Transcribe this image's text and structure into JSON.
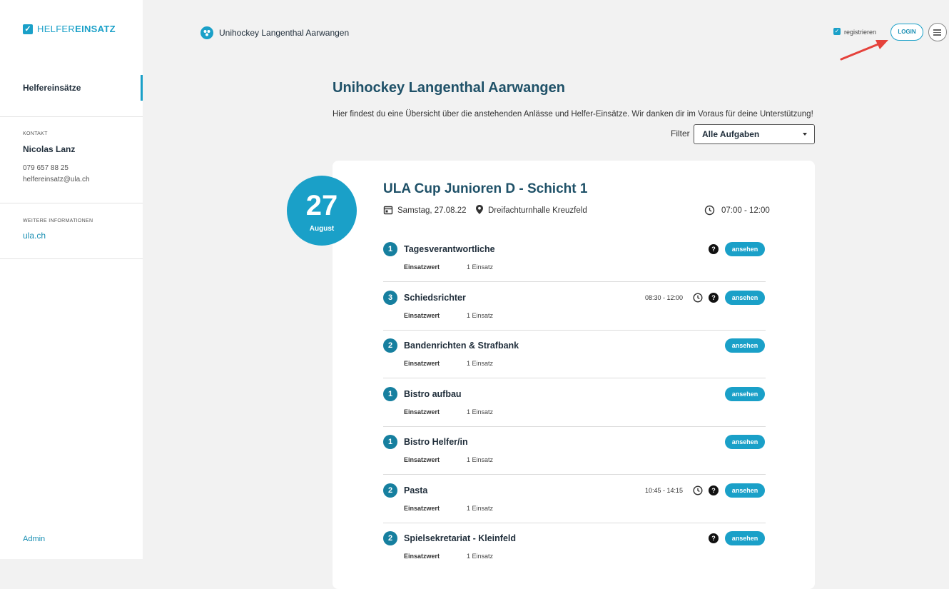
{
  "app": {
    "logo_light": "HELFER",
    "logo_bold": "EINSATZ"
  },
  "sidebar": {
    "nav_active": "Helfereinsätze",
    "contact_caption": "KONTAKT",
    "contact_name": "Nicolas Lanz",
    "contact_phone": "079 657 88 25",
    "contact_email": "helfereinsatz@ula.ch",
    "info_caption": "WEITERE INFORMATIONEN",
    "info_link": "ula.ch",
    "admin_link": "Admin"
  },
  "header": {
    "org_name": "Unihockey Langenthal Aarwangen",
    "register_label": "registrieren",
    "login_label": "LOGIN"
  },
  "main": {
    "title": "Unihockey Langenthal Aarwangen",
    "intro": "Hier findest du eine Übersicht über die anstehenden Anlässe und Helfer-Einsätze. Wir danken dir im Voraus für deine Unterstützung!",
    "filter_label": "Filter",
    "filter_value": "Alle Aufgaben"
  },
  "event": {
    "day": "27",
    "month": "August",
    "title": "ULA Cup Junioren D - Schicht 1",
    "date_text": "Samstag, 27.08.22",
    "location": "Dreifachturnhalle Kreuzfeld",
    "time": "07:00 - 12:00",
    "tasks": [
      {
        "count": "1",
        "name": "Tagesverantwortliche",
        "key": "Einsatzwert",
        "value": "1 Einsatz",
        "time": "",
        "help": "?",
        "button": "ansehen"
      },
      {
        "count": "3",
        "name": "Schiedsrichter",
        "key": "Einsatzwert",
        "value": "1 Einsatz",
        "time": "08:30 - 12:00",
        "help": "?",
        "button": "ansehen"
      },
      {
        "count": "2",
        "name": "Bandenrichten & Strafbank",
        "key": "Einsatzwert",
        "value": "1 Einsatz",
        "time": "",
        "help": "",
        "button": "ansehen"
      },
      {
        "count": "1",
        "name": "Bistro aufbau",
        "key": "Einsatzwert",
        "value": "1 Einsatz",
        "time": "",
        "help": "",
        "button": "ansehen"
      },
      {
        "count": "1",
        "name": "Bistro Helfer/in",
        "key": "Einsatzwert",
        "value": "1 Einsatz",
        "time": "",
        "help": "",
        "button": "ansehen"
      },
      {
        "count": "2",
        "name": "Pasta",
        "key": "Einsatzwert",
        "value": "1 Einsatz",
        "time": "10:45 - 14:15",
        "help": "?",
        "button": "ansehen"
      },
      {
        "count": "2",
        "name": "Spielsekretariat - Kleinfeld",
        "key": "Einsatzwert",
        "value": "1 Einsatz",
        "time": "",
        "help": "?",
        "button": "ansehen"
      }
    ]
  },
  "colors": {
    "accent": "#1aa0c8",
    "badge": "#167f9f",
    "title": "#1f5168"
  },
  "icons": [
    "check-icon",
    "org-icon",
    "menu-icon",
    "calendar-icon",
    "location-icon",
    "clock-icon",
    "help-icon",
    "dropdown-caret-icon"
  ]
}
